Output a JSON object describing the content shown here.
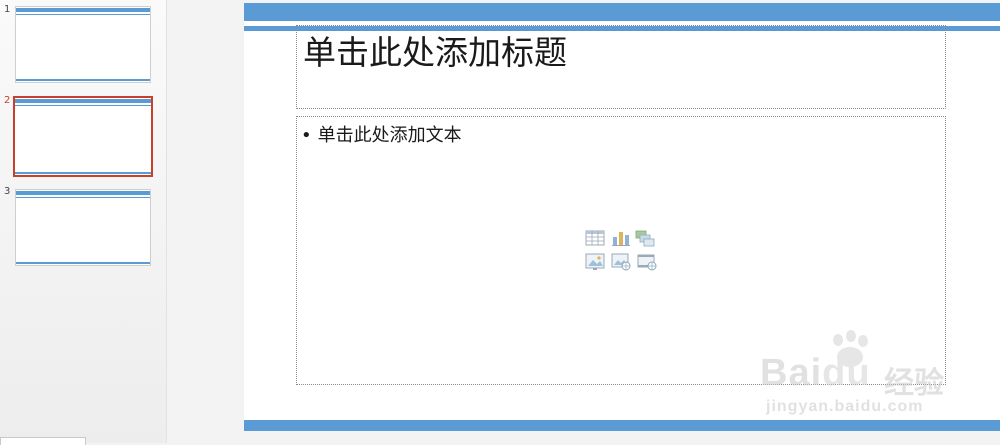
{
  "thumbnails": [
    {
      "number": "1",
      "selected": false
    },
    {
      "number": "2",
      "selected": true
    },
    {
      "number": "3",
      "selected": false
    }
  ],
  "slide": {
    "title_placeholder": "单击此处添加标题",
    "body_placeholder": "单击此处添加文本",
    "bullet": "•",
    "insert_icons": [
      "table-icon",
      "chart-icon",
      "smartart-icon",
      "picture-icon",
      "online-picture-icon",
      "video-icon"
    ],
    "accent_color": "#5b9bd5"
  },
  "watermark": {
    "brand": "Bai",
    "brand_du": "du",
    "suffix": "经验",
    "url": "jingyan.baidu.com"
  },
  "colors": {
    "selection": "#c8402a",
    "accent": "#5b9bd5"
  }
}
